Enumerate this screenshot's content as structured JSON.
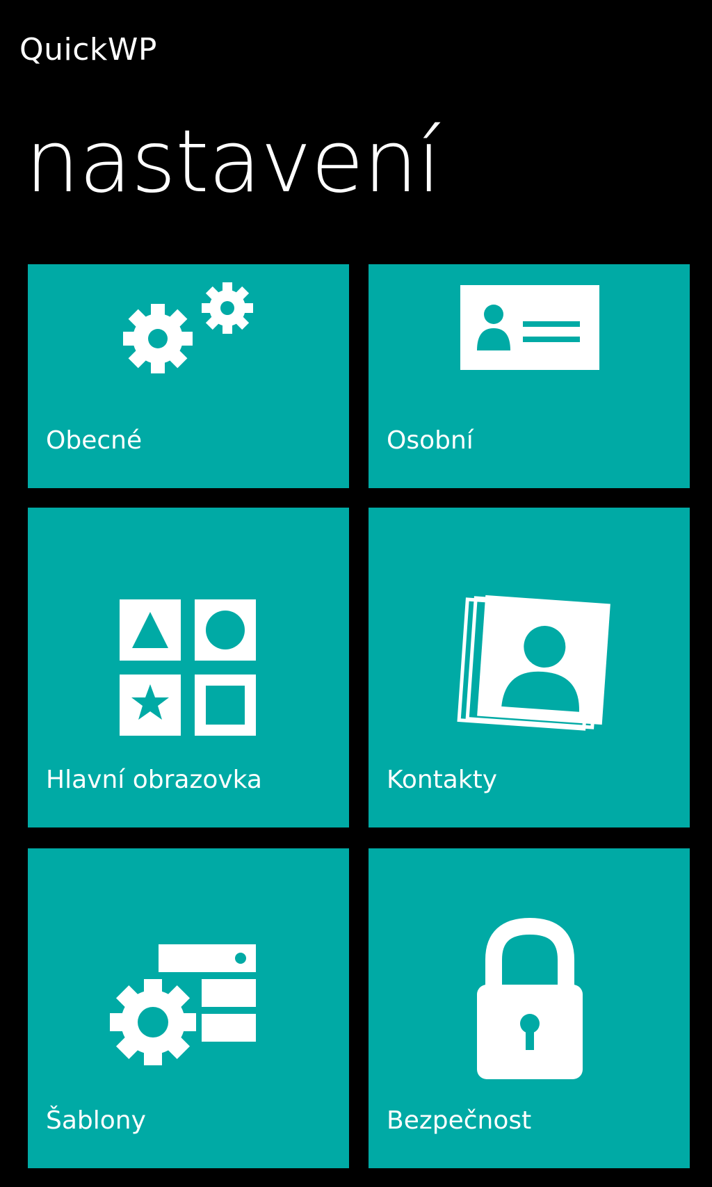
{
  "app": {
    "title": "QuickWP"
  },
  "page": {
    "title": "nastavení"
  },
  "theme": {
    "background": "#000000",
    "tile_color": "#00aaa5",
    "foreground": "#ffffff"
  },
  "tiles": [
    {
      "label": "Obecné",
      "icon": "gears-icon"
    },
    {
      "label": "Osobní",
      "icon": "id-card-icon"
    },
    {
      "label": "Hlavní obrazovka",
      "icon": "shapes-grid-icon"
    },
    {
      "label": "Kontakty",
      "icon": "contacts-icon"
    },
    {
      "label": "Šablony",
      "icon": "template-gear-icon"
    },
    {
      "label": "Bezpečnost",
      "icon": "padlock-icon"
    }
  ]
}
